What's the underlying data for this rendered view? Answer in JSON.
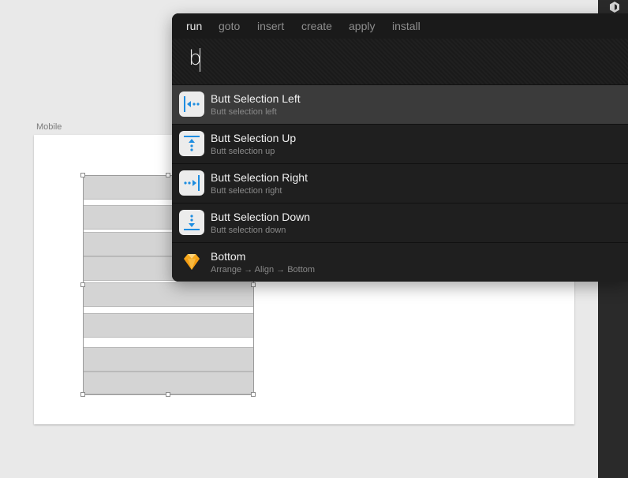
{
  "artboard": {
    "label": "Mobile"
  },
  "palette": {
    "tabs": [
      {
        "label": "run",
        "active": true
      },
      {
        "label": "goto",
        "active": false
      },
      {
        "label": "insert",
        "active": false
      },
      {
        "label": "create",
        "active": false
      },
      {
        "label": "apply",
        "active": false
      },
      {
        "label": "install",
        "active": false
      }
    ],
    "query": "b",
    "results": [
      {
        "title": "Butt Selection Left",
        "subtitle": "Butt selection left",
        "icon": "align-left-icon",
        "selected": true
      },
      {
        "title": "Butt Selection Up",
        "subtitle": "Butt selection up",
        "icon": "align-up-icon",
        "selected": false
      },
      {
        "title": "Butt Selection Right",
        "subtitle": "Butt selection right",
        "icon": "align-right-icon",
        "selected": false
      },
      {
        "title": "Butt Selection Down",
        "subtitle": "Butt selection down",
        "icon": "align-down-icon",
        "selected": false
      },
      {
        "title": "Bottom",
        "subtitle": "Arrange → Align → Bottom",
        "icon": "sketch-diamond-icon",
        "selected": false
      }
    ]
  },
  "colors": {
    "accent_blue": "#1e8de0",
    "sketch_orange": "#f7a81b"
  }
}
